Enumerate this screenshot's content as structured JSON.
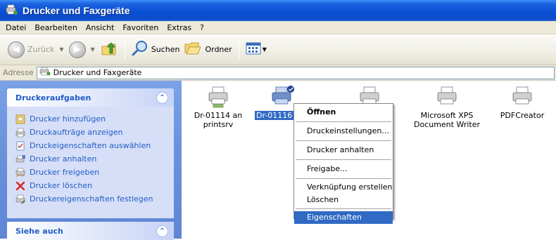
{
  "window": {
    "title": "Drucker und Faxgeräte"
  },
  "menubar": {
    "items": [
      "Datei",
      "Bearbeiten",
      "Ansicht",
      "Favoriten",
      "Extras",
      "?"
    ]
  },
  "toolbar": {
    "back_label": "Zurück",
    "search_label": "Suchen",
    "folders_label": "Ordner"
  },
  "address": {
    "label": "Adresse",
    "value": "Drucker und Faxgeräte"
  },
  "tasks_panel": {
    "title": "Druckeraufgaben",
    "items": [
      "Drucker hinzufügen",
      "Druckaufträge anzeigen",
      "Druckeigenschaften auswählen",
      "Drucker anhalten",
      "Drucker freigeben",
      "Drucker löschen",
      "Druckereigenschaften festlegen"
    ]
  },
  "see_also_panel": {
    "title": "Siehe auch"
  },
  "printers": [
    {
      "name": "Dr-01114 an printsrv"
    },
    {
      "name": "Dr-01116 a"
    },
    {
      "name": ""
    },
    {
      "name": "Microsoft XPS Document Writer"
    },
    {
      "name": "PDFCreator"
    }
  ],
  "context_menu": {
    "items": [
      "Öffnen",
      "Druckeinstellungen...",
      "Drucker anhalten",
      "Freigabe...",
      "Verknüpfung erstellen",
      "Löschen",
      "Eigenschaften"
    ]
  }
}
